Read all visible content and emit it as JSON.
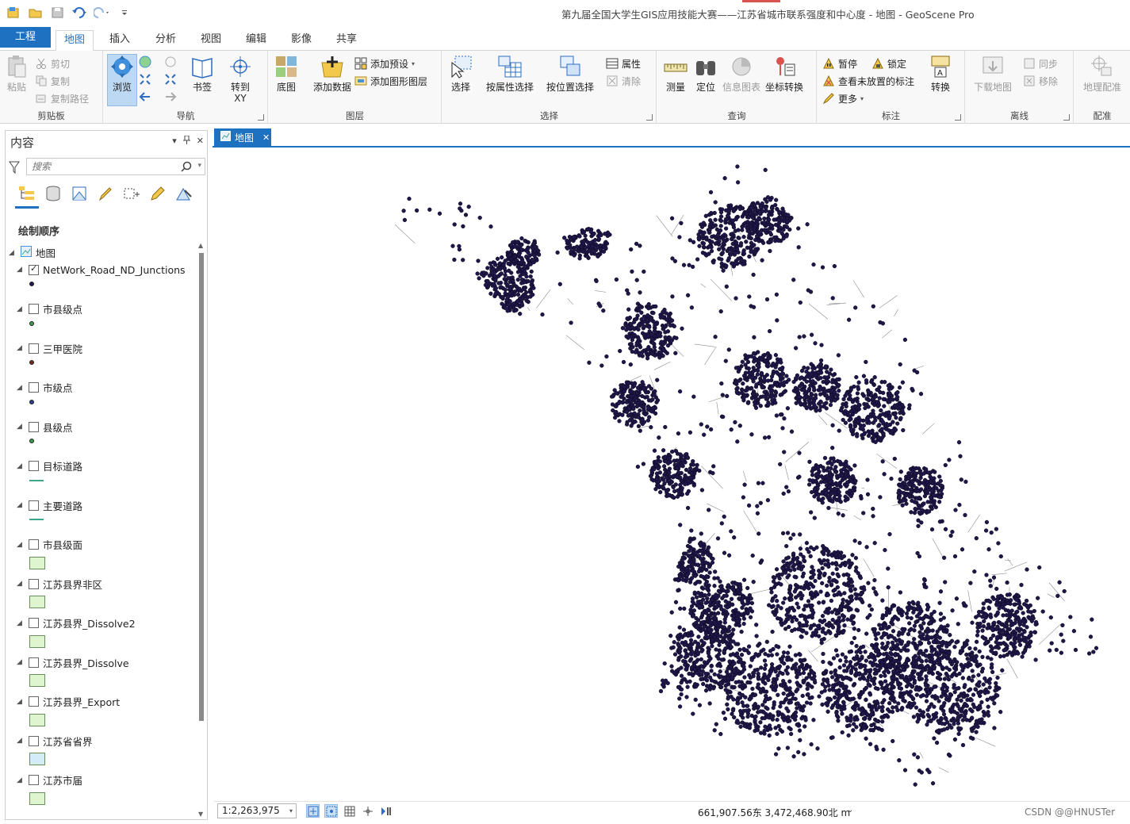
{
  "app": {
    "title": "第九届全国大学生GIS应用技能大赛——江苏省城市联系强度和中心度 - 地图 - GeoScene Pro"
  },
  "tabs": {
    "project": "工程",
    "items": [
      "地图",
      "插入",
      "分析",
      "视图",
      "编辑",
      "影像",
      "共享"
    ],
    "active": "地图"
  },
  "ribbon": {
    "clipboard": {
      "label": "剪贴板",
      "paste": "粘贴",
      "cut": "剪切",
      "copy": "复制",
      "copy_path": "复制路径"
    },
    "navigate": {
      "label": "导航",
      "explore": "浏览",
      "bookmarks": "书签",
      "goto_xy": "转到\nXY"
    },
    "layer": {
      "label": "图层",
      "basemap": "底图",
      "add_data": "添加数据",
      "add_preset": "添加预设",
      "add_graphics_layer": "添加图形图层"
    },
    "selection": {
      "label": "选择",
      "select": "选择",
      "select_by_attributes": "按属性选择",
      "select_by_location": "按位置选择",
      "attributes": "属性",
      "clear": "清除"
    },
    "inquiry": {
      "label": "查询",
      "measure": "测量",
      "locate": "定位",
      "infographics": "信息图表",
      "coordinate_conversion": "坐标转换"
    },
    "labeling": {
      "label": "标注",
      "pause": "暂停",
      "lock": "锁定",
      "view_unplaced": "查看未放置的标注",
      "more": "更多",
      "convert": "转换"
    },
    "offline": {
      "label": "离线",
      "download_map": "下载地图",
      "sync": "同步",
      "remove": "移除"
    },
    "georeference": {
      "label": "配准",
      "georeference": "地理配准"
    }
  },
  "contents": {
    "title": "内容",
    "search_placeholder": "搜索",
    "draw_order": "绘制顺序",
    "map_name": "地图",
    "layers": [
      {
        "name": "NetWork_Road_ND_Junctions",
        "checked": true,
        "symbol": "point",
        "color": "#1f1a4f"
      },
      {
        "name": "市县级点",
        "checked": false,
        "symbol": "point",
        "color": "#3a9a4a"
      },
      {
        "name": "三甲医院",
        "checked": false,
        "symbol": "point",
        "color": "#7a2a1a"
      },
      {
        "name": "市级点",
        "checked": false,
        "symbol": "point",
        "color": "#2d3f8f"
      },
      {
        "name": "县级点",
        "checked": false,
        "symbol": "point",
        "color": "#3a9a4a"
      },
      {
        "name": "目标道路",
        "checked": false,
        "symbol": "line",
        "color": "#3fa58c"
      },
      {
        "name": "主要道路",
        "checked": false,
        "symbol": "line",
        "color": "#3fa58c"
      },
      {
        "name": "市县级面",
        "checked": false,
        "symbol": "polygon",
        "color": "#dff5d0"
      },
      {
        "name": "江苏县界非区",
        "checked": false,
        "symbol": "polygon",
        "color": "#dff5d0"
      },
      {
        "name": "江苏县界_Dissolve2",
        "checked": false,
        "symbol": "polygon",
        "color": "#dff5d0"
      },
      {
        "name": "江苏县界_Dissolve",
        "checked": false,
        "symbol": "polygon",
        "color": "#dff5d0"
      },
      {
        "name": "江苏县界_Export",
        "checked": false,
        "symbol": "polygon",
        "color": "#dff5d0"
      },
      {
        "name": "江苏省省界",
        "checked": false,
        "symbol": "polygon",
        "color": "#d3ecf7"
      },
      {
        "name": "江苏市届",
        "checked": false,
        "symbol": "polygon",
        "color": "#dff5d0"
      }
    ]
  },
  "map_view": {
    "tab_label": "地图",
    "point_color": "#1e1748",
    "road_color": "#8c8c8c"
  },
  "status": {
    "scale": "1:2,263,975",
    "coordinates": "661,907.56东 3,472,468.90北 m",
    "watermark": "CSDN @@HNUSTer"
  }
}
